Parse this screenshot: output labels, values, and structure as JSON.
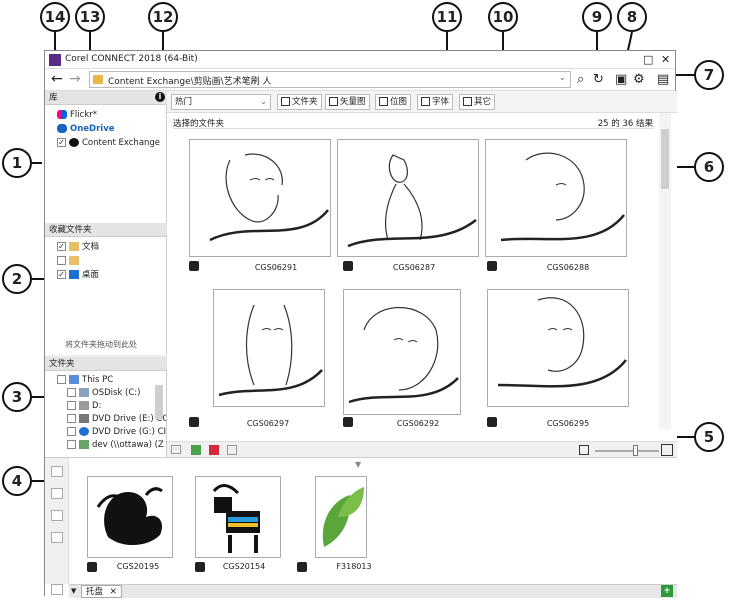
{
  "window": {
    "title": "Corel CONNECT 2018 (64-Bit)",
    "controls": {
      "maximize": "□",
      "close": "✕"
    }
  },
  "navigation": {
    "back_icon": "←",
    "forward_icon": "→",
    "address": "Content Exchange\\剪贴画\\艺术笔刷 人",
    "dropdown_icon": "⌄",
    "search_icon": "⌕",
    "refresh_icon": "↻",
    "new_window_icon": "▣",
    "settings_icon": "⚙",
    "tray_icon": "▤"
  },
  "library": {
    "header": "库",
    "info_icon": "i",
    "items": [
      {
        "label": "Flickr*",
        "checked": false
      },
      {
        "label": "OneDrive",
        "checked": false
      },
      {
        "label": "Content Exchange",
        "checked": true
      }
    ]
  },
  "favorites": {
    "header": "收藏文件夹",
    "items": [
      {
        "label": "文档",
        "checked": true
      },
      {
        "label": "",
        "checked": false
      },
      {
        "label": "桌面",
        "checked": true
      }
    ],
    "hint": "将文件夹拖动到此处"
  },
  "folders": {
    "header": "文件夹",
    "items": [
      {
        "label": "This PC",
        "checked": false
      },
      {
        "label": "OSDisk (C:)",
        "checked": false
      },
      {
        "label": "D:",
        "checked": false
      },
      {
        "label": "DVD Drive (E:) CC",
        "checked": false
      },
      {
        "label": "DVD Drive (G:) CI",
        "checked": false
      },
      {
        "label": "dev (\\\\ottawa) (Z",
        "checked": false
      }
    ]
  },
  "toolbar": {
    "filter": "热门",
    "buttons": [
      {
        "label": "文件夹"
      },
      {
        "label": "矢量图"
      },
      {
        "label": "位图"
      },
      {
        "label": "字体"
      },
      {
        "label": "其它"
      }
    ]
  },
  "content": {
    "section_title": "选择的文件夹",
    "result_count": "25 的 36 结果",
    "items": [
      {
        "caption": "CGS06291"
      },
      {
        "caption": "CGS06287"
      },
      {
        "caption": "CGS06288"
      },
      {
        "caption": "CGS06297"
      },
      {
        "caption": "CGS06292"
      },
      {
        "caption": "CGS06295"
      }
    ]
  },
  "tray": {
    "tab_label": "托盘",
    "tab_close": "✕",
    "add_icon": "+",
    "items": [
      {
        "caption": "CGS20195"
      },
      {
        "caption": "CGS20154"
      },
      {
        "caption": "F318013"
      }
    ]
  },
  "callouts": [
    "1",
    "2",
    "3",
    "4",
    "5",
    "6",
    "7",
    "8",
    "9",
    "10",
    "11",
    "12",
    "13",
    "14"
  ]
}
